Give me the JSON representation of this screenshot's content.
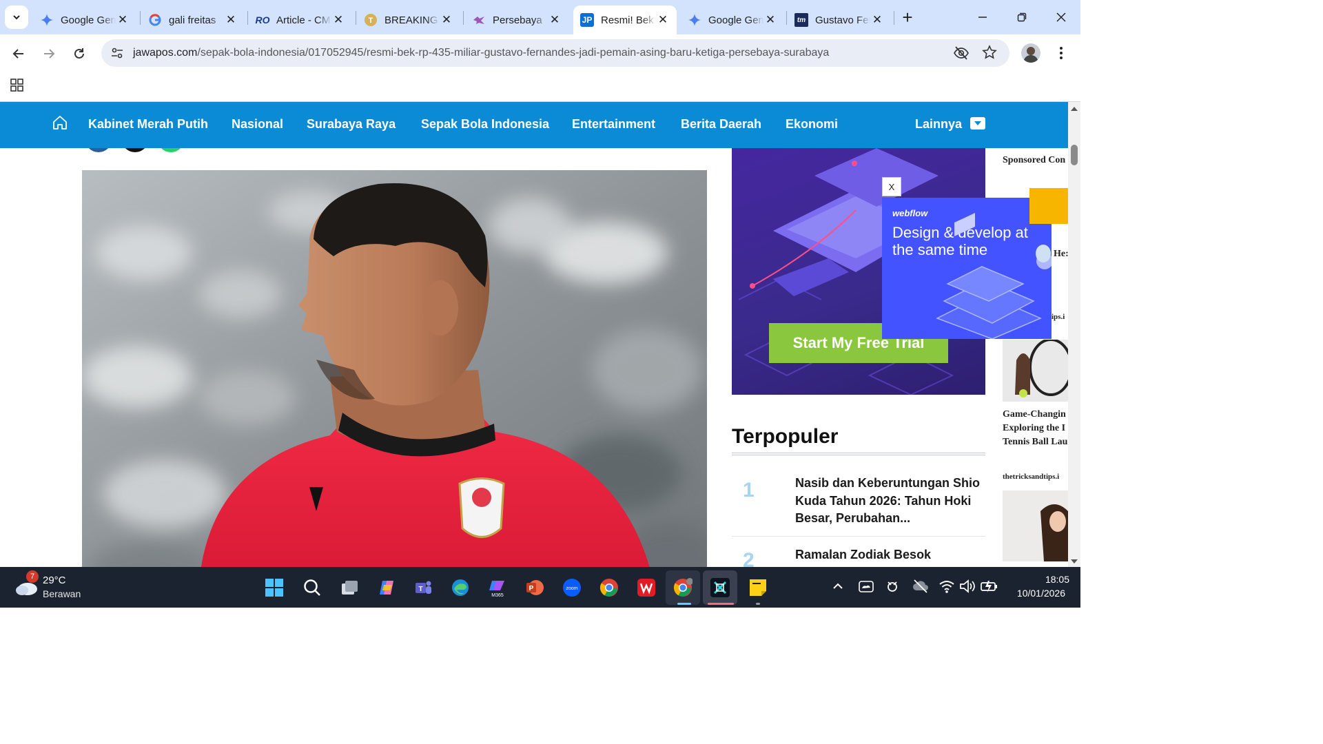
{
  "browser": {
    "tabs": [
      {
        "title": "Google Gemini",
        "icon": "gemini-icon"
      },
      {
        "title": "gali freitas",
        "icon": "google-icon"
      },
      {
        "title": "Article - CMS",
        "icon": "cms-icon"
      },
      {
        "title": "BREAKING",
        "icon": "tribun-icon"
      },
      {
        "title": "Persebaya",
        "icon": "persebaya-icon"
      },
      {
        "title": "Resmi! Bek",
        "icon": "jawapos-icon",
        "active": true
      },
      {
        "title": "Google Gemini",
        "icon": "gemini-icon"
      },
      {
        "title": "Gustavo Fernandes",
        "icon": "transfermarkt-icon"
      }
    ],
    "url_host": "jawapos.com",
    "url_path": "/sepak-bola-indonesia/017052945/resmi-bek-rp-435-miliar-gustavo-fernandes-jadi-pemain-asing-baru-ketiga-persebaya-surabaya"
  },
  "sitenav": {
    "items": [
      "Kabinet Merah Putih",
      "Nasional",
      "Surabaya Raya",
      "Sepak Bola Indonesia",
      "Entertainment",
      "Berita Daerah",
      "Ekonomi"
    ],
    "more": "Lainnya",
    "colors": {
      "nav_bg": "#0b8bd6",
      "cta": "#8bc63f"
    }
  },
  "ads": {
    "big_cta": "Start My Free Trial",
    "close": "X",
    "popup_brand": "webflow",
    "popup_headline": "Design & develop at the same time"
  },
  "terpopuler": {
    "heading": "Terpopuler",
    "items": [
      {
        "rank": "1",
        "title": "Nasib dan Keberuntungan Shio Kuda Tahun 2026: Tahun Hoki Besar, Perubahan..."
      },
      {
        "rank": "2",
        "title": "Ramalan Zodiak Besok"
      }
    ]
  },
  "sidebar": {
    "sponsored": "Sponsored Con",
    "fragment_1": "He:",
    "fragment_2": "ips.i",
    "headline": [
      "Game-Changin",
      "Exploring the I",
      "Tennis Ball Lau"
    ],
    "source": "thetricksandtips.i"
  },
  "taskbar": {
    "temp": "29°C",
    "weather": "Berawan",
    "badge": "7",
    "time": "18:05",
    "date": "10/01/2026"
  }
}
